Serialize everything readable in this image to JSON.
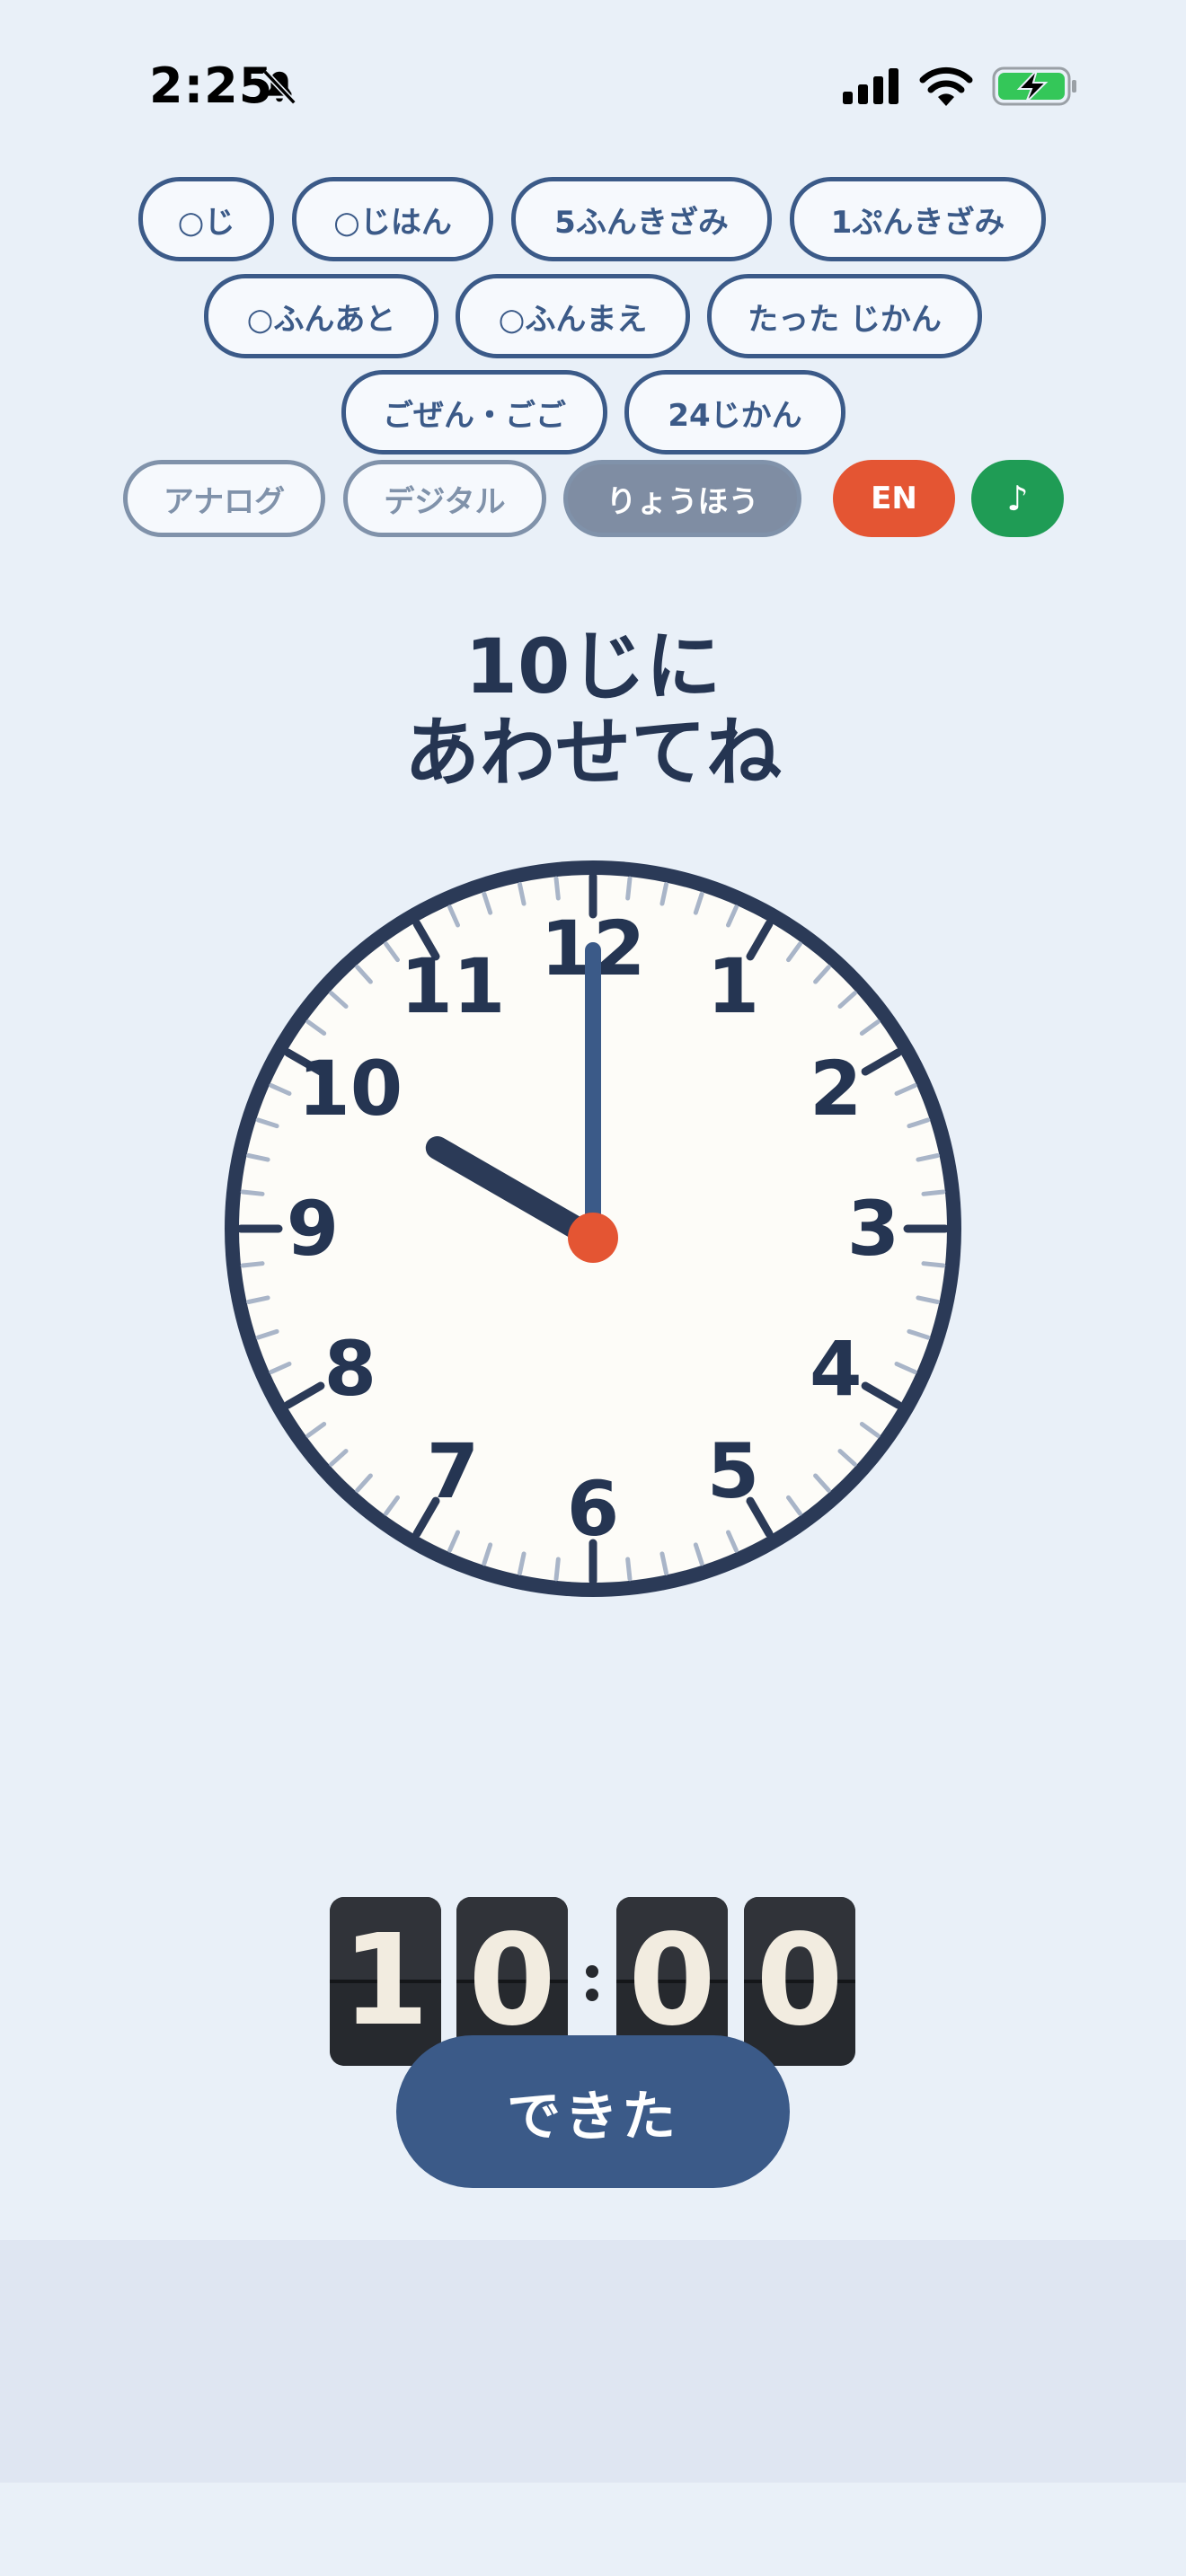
{
  "status_bar": {
    "time": "2:25"
  },
  "modes": [
    {
      "label": "○じ",
      "active": true
    },
    {
      "label": "○じはん",
      "active": false
    },
    {
      "label": "5ふんきざみ",
      "active": false
    },
    {
      "label": "1ぷんきざみ",
      "active": false
    },
    {
      "label": "○ふんあと",
      "active": false
    },
    {
      "label": "○ふんまえ",
      "active": false
    },
    {
      "label": "たった じかん",
      "active": false
    },
    {
      "label": "ごぜん・ごご",
      "active": false
    },
    {
      "label": "24じかん",
      "active": false
    }
  ],
  "views": [
    {
      "label": "アナログ",
      "active": false
    },
    {
      "label": "デジタル",
      "active": false
    },
    {
      "label": "りょうほう",
      "active": true
    }
  ],
  "language_button": "EN",
  "music_button": "♪",
  "instruction": {
    "line1": "10じに",
    "line2": "あわせてね"
  },
  "clock": {
    "numerals": [
      "12",
      "1",
      "2",
      "3",
      "4",
      "5",
      "6",
      "7",
      "8",
      "9",
      "10",
      "11"
    ],
    "hour": 10,
    "minute": 0,
    "colors": {
      "face": "#fdfcf8",
      "rim": "#2b3a57",
      "hour_hand": "#2b3a57",
      "minute_hand": "#3b5a88",
      "center": "#e45533",
      "minor_tick": "#a9b5c8"
    }
  },
  "digital": {
    "digits": [
      "1",
      "0",
      "0",
      "0"
    ]
  },
  "done_button": "できた",
  "colors": {
    "background": "#e9f0f8",
    "primary": "#3b5a88",
    "accent_red": "#e45533",
    "accent_green": "#1f9c55"
  }
}
